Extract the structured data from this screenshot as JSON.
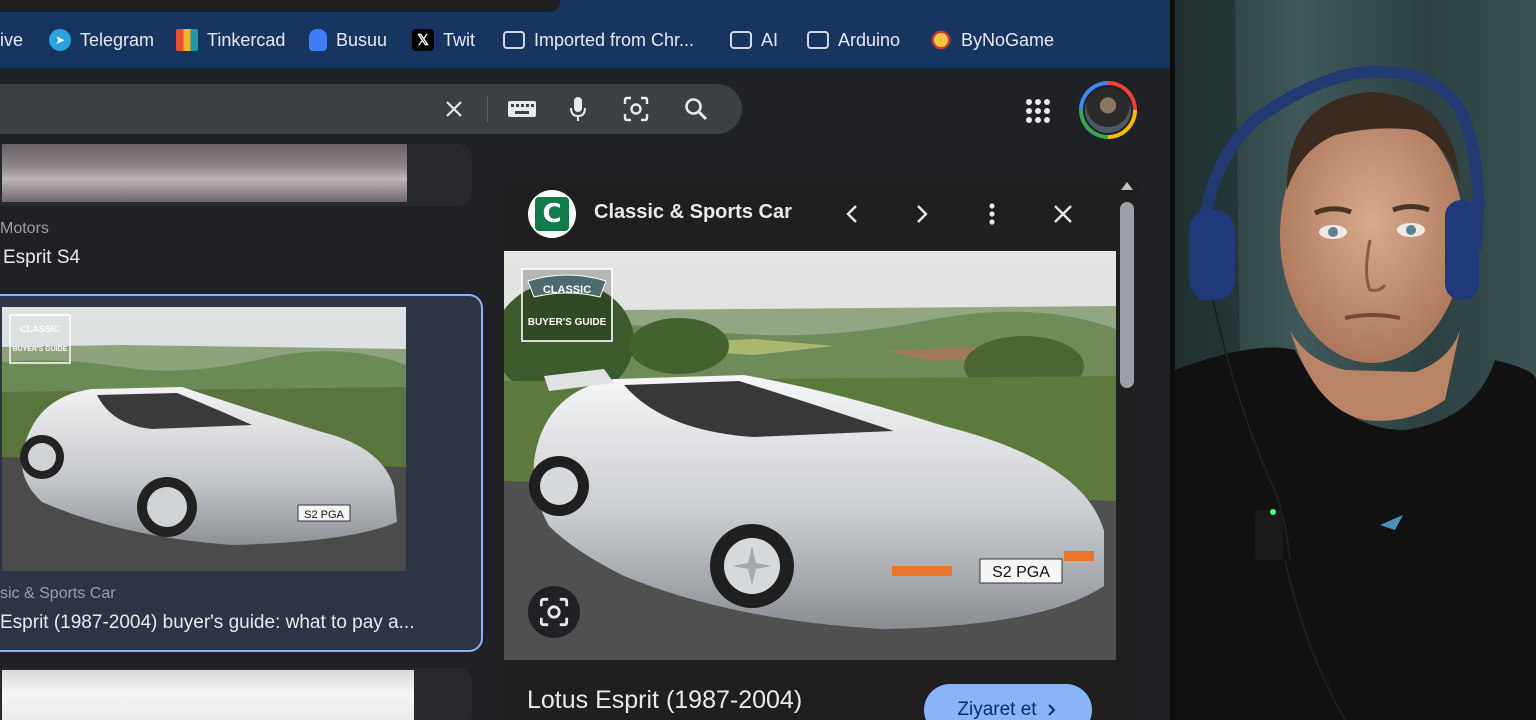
{
  "bookmarks": [
    {
      "label": "rive",
      "icon": "drive-icon"
    },
    {
      "label": "Telegram",
      "icon": "telegram-icon"
    },
    {
      "label": "Tinkercad",
      "icon": "tinkercad-icon"
    },
    {
      "label": "Busuu",
      "icon": "busuu-icon"
    },
    {
      "label": "Twit",
      "icon": "x-icon"
    },
    {
      "label": "Imported from Chr...",
      "icon": "folder-icon"
    },
    {
      "label": "AI",
      "icon": "folder-icon"
    },
    {
      "label": "Arduino",
      "icon": "folder-icon"
    },
    {
      "label": "ByNoGame",
      "icon": "bynogame-icon"
    }
  ],
  "results": {
    "first": {
      "source": "Motors",
      "title": "Esprit S4"
    },
    "selected": {
      "source": "sic & Sports Car",
      "title": "Esprit (1987-2004) buyer's guide: what to pay a..."
    }
  },
  "preview": {
    "site": "Classic & Sports Car",
    "logo_letter": "C",
    "badge_top": "CLASSIC",
    "badge_bottom": "BUYER'S GUIDE",
    "plate": "S2 PGA",
    "title": "Lotus Esprit (1987-2004)",
    "visit_label": "Ziyaret et"
  },
  "colors": {
    "bookmark_bar": "#163561",
    "page_bg": "#202124",
    "accent": "#8ab4f8",
    "visit_text": "#062e6f"
  }
}
